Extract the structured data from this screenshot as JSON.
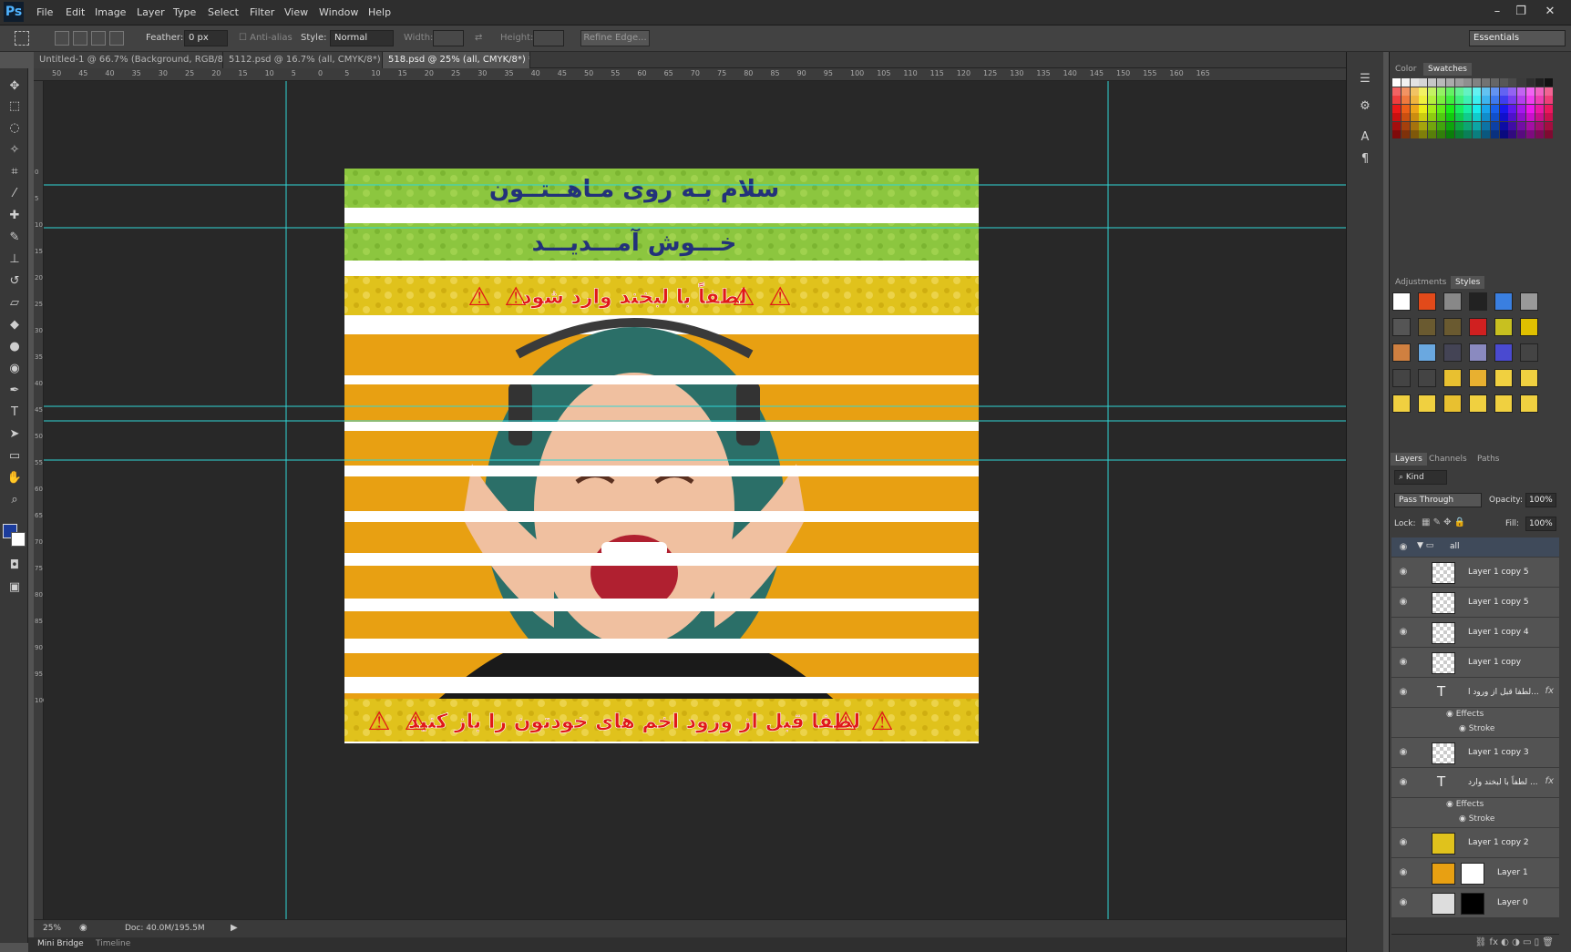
{
  "app": {
    "logo": "Ps"
  },
  "menu": [
    "File",
    "Edit",
    "Image",
    "Layer",
    "Type",
    "Select",
    "Filter",
    "View",
    "Window",
    "Help"
  ],
  "window_controls": {
    "minimize": "–",
    "restore": "❐",
    "close": "✕"
  },
  "options": {
    "feather_label": "Feather:",
    "feather_value": "0 px",
    "antialias_label": "Anti-alias",
    "style_label": "Style:",
    "style_value": "Normal",
    "width_label": "Width:",
    "height_label": "Height:",
    "refine_label": "Refine Edge...",
    "workspace": "Essentials"
  },
  "tabs": [
    {
      "label": "Untitled-1 @ 66.7% (Background, RGB/8) *"
    },
    {
      "label": "5112.psd @ 16.7% (all, CMYK/8*) *"
    },
    {
      "label": "518.psd @ 25% (all, CMYK/8*) *"
    }
  ],
  "ruler_top": [
    "50",
    "45",
    "40",
    "35",
    "30",
    "25",
    "20",
    "15",
    "10",
    "5",
    "0",
    "5",
    "10",
    "15",
    "20",
    "25",
    "30",
    "35",
    "40",
    "45",
    "50",
    "55",
    "60",
    "65",
    "70",
    "75",
    "80",
    "85",
    "90",
    "95",
    "100",
    "105",
    "110",
    "115",
    "120",
    "125",
    "130",
    "135",
    "140",
    "145",
    "150",
    "155",
    "160",
    "165"
  ],
  "ruler_left": [
    "0",
    "5",
    "10",
    "15",
    "20",
    "25",
    "30",
    "35",
    "40",
    "45",
    "50",
    "55",
    "60",
    "65",
    "70",
    "75",
    "80",
    "85",
    "90",
    "95",
    "100"
  ],
  "artwork": {
    "title1": "سلام بـه روی مـاهــتــون",
    "title2": "خـــوش آمـــدیـــد",
    "notice1": "لطفاً با لبخند وارد شود",
    "notice2": "لطفا قبل از ورود اخم های خودتون را باز کنید",
    "warning_glyph": "⚠"
  },
  "status": {
    "zoom": "25%",
    "doc": "Doc: 40.0M/195.5M"
  },
  "bottom_tabs": [
    "Mini Bridge",
    "Timeline"
  ],
  "panels": {
    "color_tabs": [
      "Color",
      "Swatches"
    ],
    "style_tabs": [
      "Adjustments",
      "Styles"
    ],
    "layer_tabs": [
      "Layers",
      "Channels",
      "Paths"
    ],
    "kind_label": "Kind",
    "blend_mode": "Pass Through",
    "opacity_label": "Opacity:",
    "opacity_value": "100%",
    "lock_label": "Lock:",
    "fill_label": "Fill:",
    "fill_value": "100%"
  },
  "layers": [
    {
      "name": "all",
      "type": "group"
    },
    {
      "name": "Layer 1 copy 5",
      "type": "layer"
    },
    {
      "name": "Layer 1 copy 5",
      "type": "layer"
    },
    {
      "name": "Layer 1 copy 4",
      "type": "layer"
    },
    {
      "name": "Layer 1 copy",
      "type": "layer"
    },
    {
      "name": "لطفا قبل از ورود ا...",
      "type": "text",
      "effects": [
        "Effects",
        "Stroke"
      ]
    },
    {
      "name": "Layer 1 copy 3",
      "type": "layer"
    },
    {
      "name": "لطفاً با لبخند وارد ...",
      "type": "text",
      "effects": [
        "Effects",
        "Stroke"
      ]
    },
    {
      "name": "Layer 1 copy 2",
      "type": "layer"
    },
    {
      "name": "Layer 1",
      "type": "image"
    },
    {
      "name": "Layer 0",
      "type": "image"
    }
  ],
  "colors": {
    "guide": "#2fd6d6",
    "banner_green": "#8cc63f",
    "banner_yellow": "#e0c21c",
    "background_orange": "#e8a012",
    "title_blue": "#23327a",
    "notice_red": "#e01818"
  }
}
